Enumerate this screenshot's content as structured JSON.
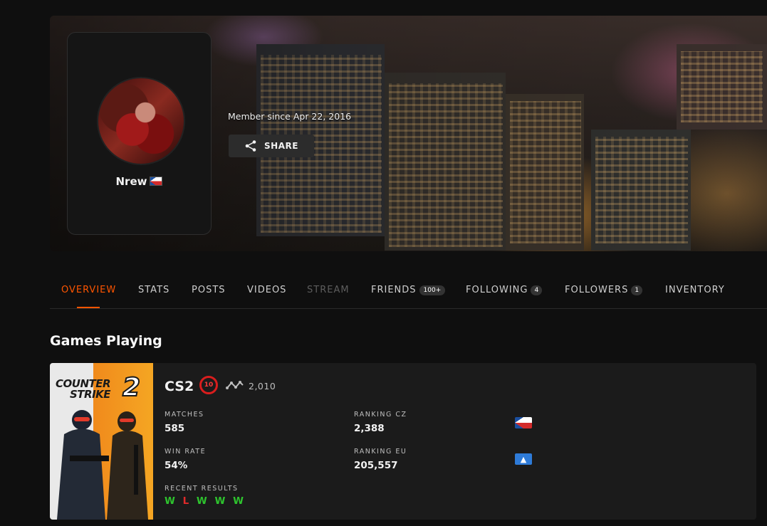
{
  "profile": {
    "username": "Nrew",
    "country_flag": "CZ",
    "member_since": "Member since Apr 22, 2016",
    "share_label": "SHARE"
  },
  "tabs": [
    {
      "label": "OVERVIEW",
      "active": true
    },
    {
      "label": "STATS"
    },
    {
      "label": "POSTS"
    },
    {
      "label": "VIDEOS"
    },
    {
      "label": "STREAM",
      "disabled": true
    },
    {
      "label": "FRIENDS",
      "badge": "100+"
    },
    {
      "label": "FOLLOWING",
      "badge": "4"
    },
    {
      "label": "FOLLOWERS",
      "badge": "1"
    },
    {
      "label": "INVENTORY"
    }
  ],
  "games_section": {
    "title": "Games Playing"
  },
  "game": {
    "name": "CS2",
    "level": "10",
    "elo": "2,010",
    "cover_text_line1": "COUNTER",
    "cover_text_line2": "STRIKE",
    "cover_number": "2",
    "stats": {
      "matches_label": "MATCHES",
      "matches_value": "585",
      "win_rate_label": "WIN RATE",
      "win_rate_value": "54%",
      "ranking_cz_label": "RANKING CZ",
      "ranking_cz_value": "2,388",
      "ranking_eu_label": "RANKING EU",
      "ranking_eu_value": "205,557",
      "recent_results_label": "RECENT RESULTS",
      "recent_results": [
        "W",
        "L",
        "W",
        "W",
        "W"
      ]
    }
  },
  "colors": {
    "accent": "#ff5500",
    "win": "#2ec32e",
    "loss": "#e02a2a",
    "level_badge": "#d91d1d"
  }
}
